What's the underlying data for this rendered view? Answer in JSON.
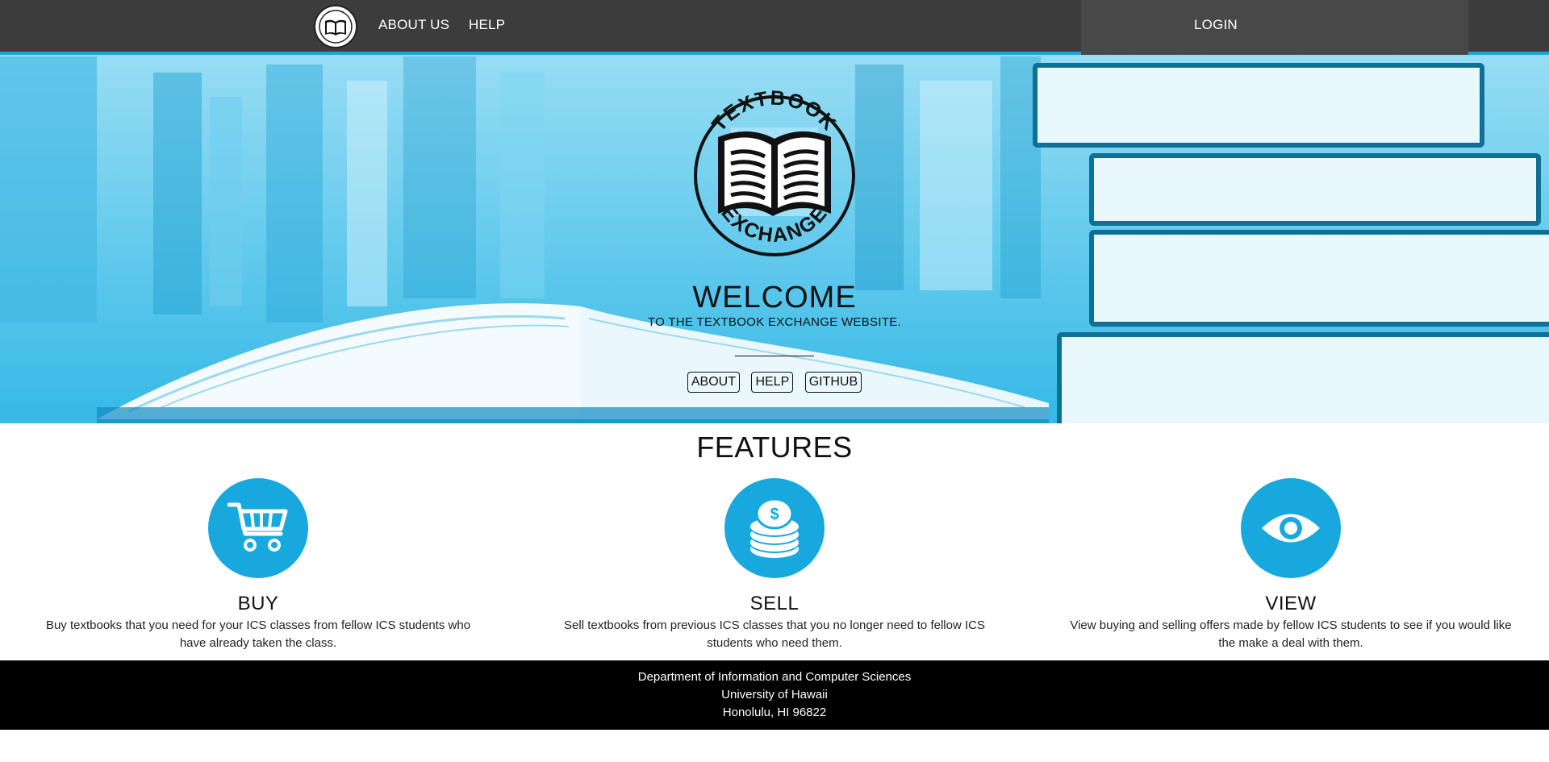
{
  "nav": {
    "logo_alt": "TEXTBOOK EXCHANGE",
    "about_us": "ABOUT US",
    "help": "HELP",
    "login": "LOGIN"
  },
  "hero": {
    "welcome": "WELCOME",
    "subtitle": "TO THE TEXTBOOK EXCHANGE WEBSITE.",
    "buttons": [
      "ABOUT",
      "HELP",
      "GITHUB"
    ]
  },
  "features": {
    "title": "FEATURES",
    "items": [
      {
        "icon": "shopping-cart-icon",
        "title": "BUY",
        "desc": "Buy textbooks that you need for your ICS classes from fellow ICS students who have already taken the class."
      },
      {
        "icon": "coins-icon",
        "title": "SELL",
        "desc": "Sell textbooks from previous ICS classes that you no longer need to fellow ICS students who need them."
      },
      {
        "icon": "eye-icon",
        "title": "VIEW",
        "desc": "View buying and selling offers made by fellow ICS students to see if you would like the make a deal with them."
      }
    ]
  },
  "footer": {
    "line1": "Department of Information and Computer Sciences",
    "line2": "University of Hawaii",
    "line3": "Honolulu, HI 96822"
  },
  "colors": {
    "accent": "#17a8de",
    "nav_bg": "#3c3c3c",
    "footer_bg": "#000000"
  }
}
